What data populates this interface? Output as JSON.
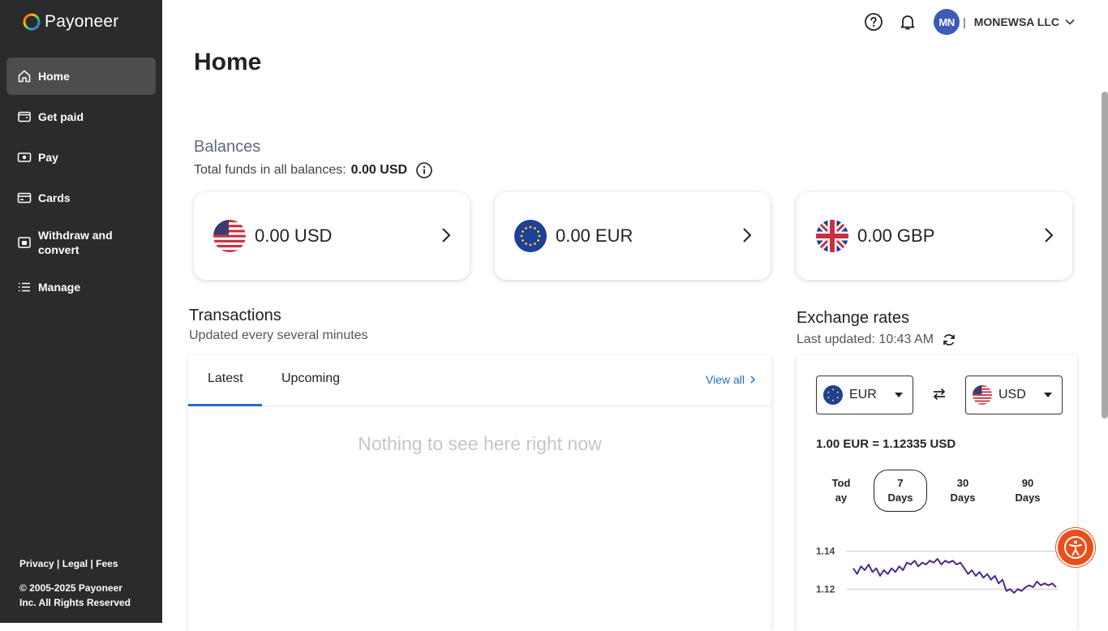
{
  "brand": {
    "name": "Payoneer"
  },
  "sidebar": {
    "items": [
      {
        "label": "Home",
        "icon": "home-icon"
      },
      {
        "label": "Get paid",
        "icon": "wallet-icon"
      },
      {
        "label": "Pay",
        "icon": "money-icon"
      },
      {
        "label": "Cards",
        "icon": "card-icon"
      },
      {
        "label": "Withdraw and convert",
        "icon": "withdraw-icon"
      },
      {
        "label": "Manage",
        "icon": "list-icon"
      }
    ],
    "footer": {
      "privacy": "Privacy",
      "legal": "Legal",
      "fees": "Fees",
      "copyright": "© 2005-2025 Payoneer Inc. All Rights Reserved"
    }
  },
  "header": {
    "avatar_initials": "MN",
    "company": "MONEWSA LLC"
  },
  "page": {
    "title": "Home"
  },
  "balances": {
    "heading": "Balances",
    "total_label": "Total funds in all balances:",
    "total_value": "0.00 USD",
    "cards": [
      {
        "amount": "0.00 USD",
        "flag": "us-flag-icon"
      },
      {
        "amount": "0.00 EUR",
        "flag": "eu-flag-icon"
      },
      {
        "amount": "0.00 GBP",
        "flag": "uk-flag-icon"
      }
    ]
  },
  "transactions": {
    "heading": "Transactions",
    "subheading": "Updated every several minutes",
    "tabs": [
      "Latest",
      "Upcoming"
    ],
    "view_all": "View all",
    "empty": "Nothing to see here right now"
  },
  "exchange": {
    "heading": "Exchange rates",
    "last_updated": "Last updated: 10:43 AM",
    "from": "EUR",
    "to": "USD",
    "rate": "1.00 EUR = 1.12335 USD",
    "ranges": [
      {
        "line1": "Tod",
        "line2": "ay"
      },
      {
        "line1": "7",
        "line2": "Days"
      },
      {
        "line1": "30",
        "line2": "Days"
      },
      {
        "line1": "90",
        "line2": "Days"
      }
    ],
    "active_range": 1,
    "colors": {
      "line": "#4b2a8c",
      "accent": "#1f6fc5"
    }
  },
  "chart_data": {
    "type": "line",
    "title": "",
    "xlabel": "",
    "ylabel": "",
    "y_ticks": [
      "1.14",
      "1.12"
    ],
    "ylim": [
      1.115,
      1.145
    ],
    "series": [
      {
        "values": [
          1.131,
          1.128,
          1.132,
          1.13,
          1.133,
          1.129,
          1.131,
          1.127,
          1.13,
          1.128,
          1.131,
          1.129,
          1.132,
          1.13,
          1.134,
          1.133,
          1.135,
          1.132,
          1.134,
          1.133,
          1.135,
          1.134,
          1.136,
          1.133,
          1.135,
          1.134,
          1.135,
          1.133,
          1.134,
          1.131,
          1.128,
          1.13,
          1.127,
          1.129,
          1.126,
          1.128,
          1.125,
          1.127,
          1.123,
          1.125,
          1.119,
          1.12,
          1.118,
          1.12,
          1.119,
          1.121,
          1.122,
          1.121,
          1.124,
          1.122,
          1.123,
          1.122,
          1.123,
          1.121
        ]
      }
    ]
  }
}
